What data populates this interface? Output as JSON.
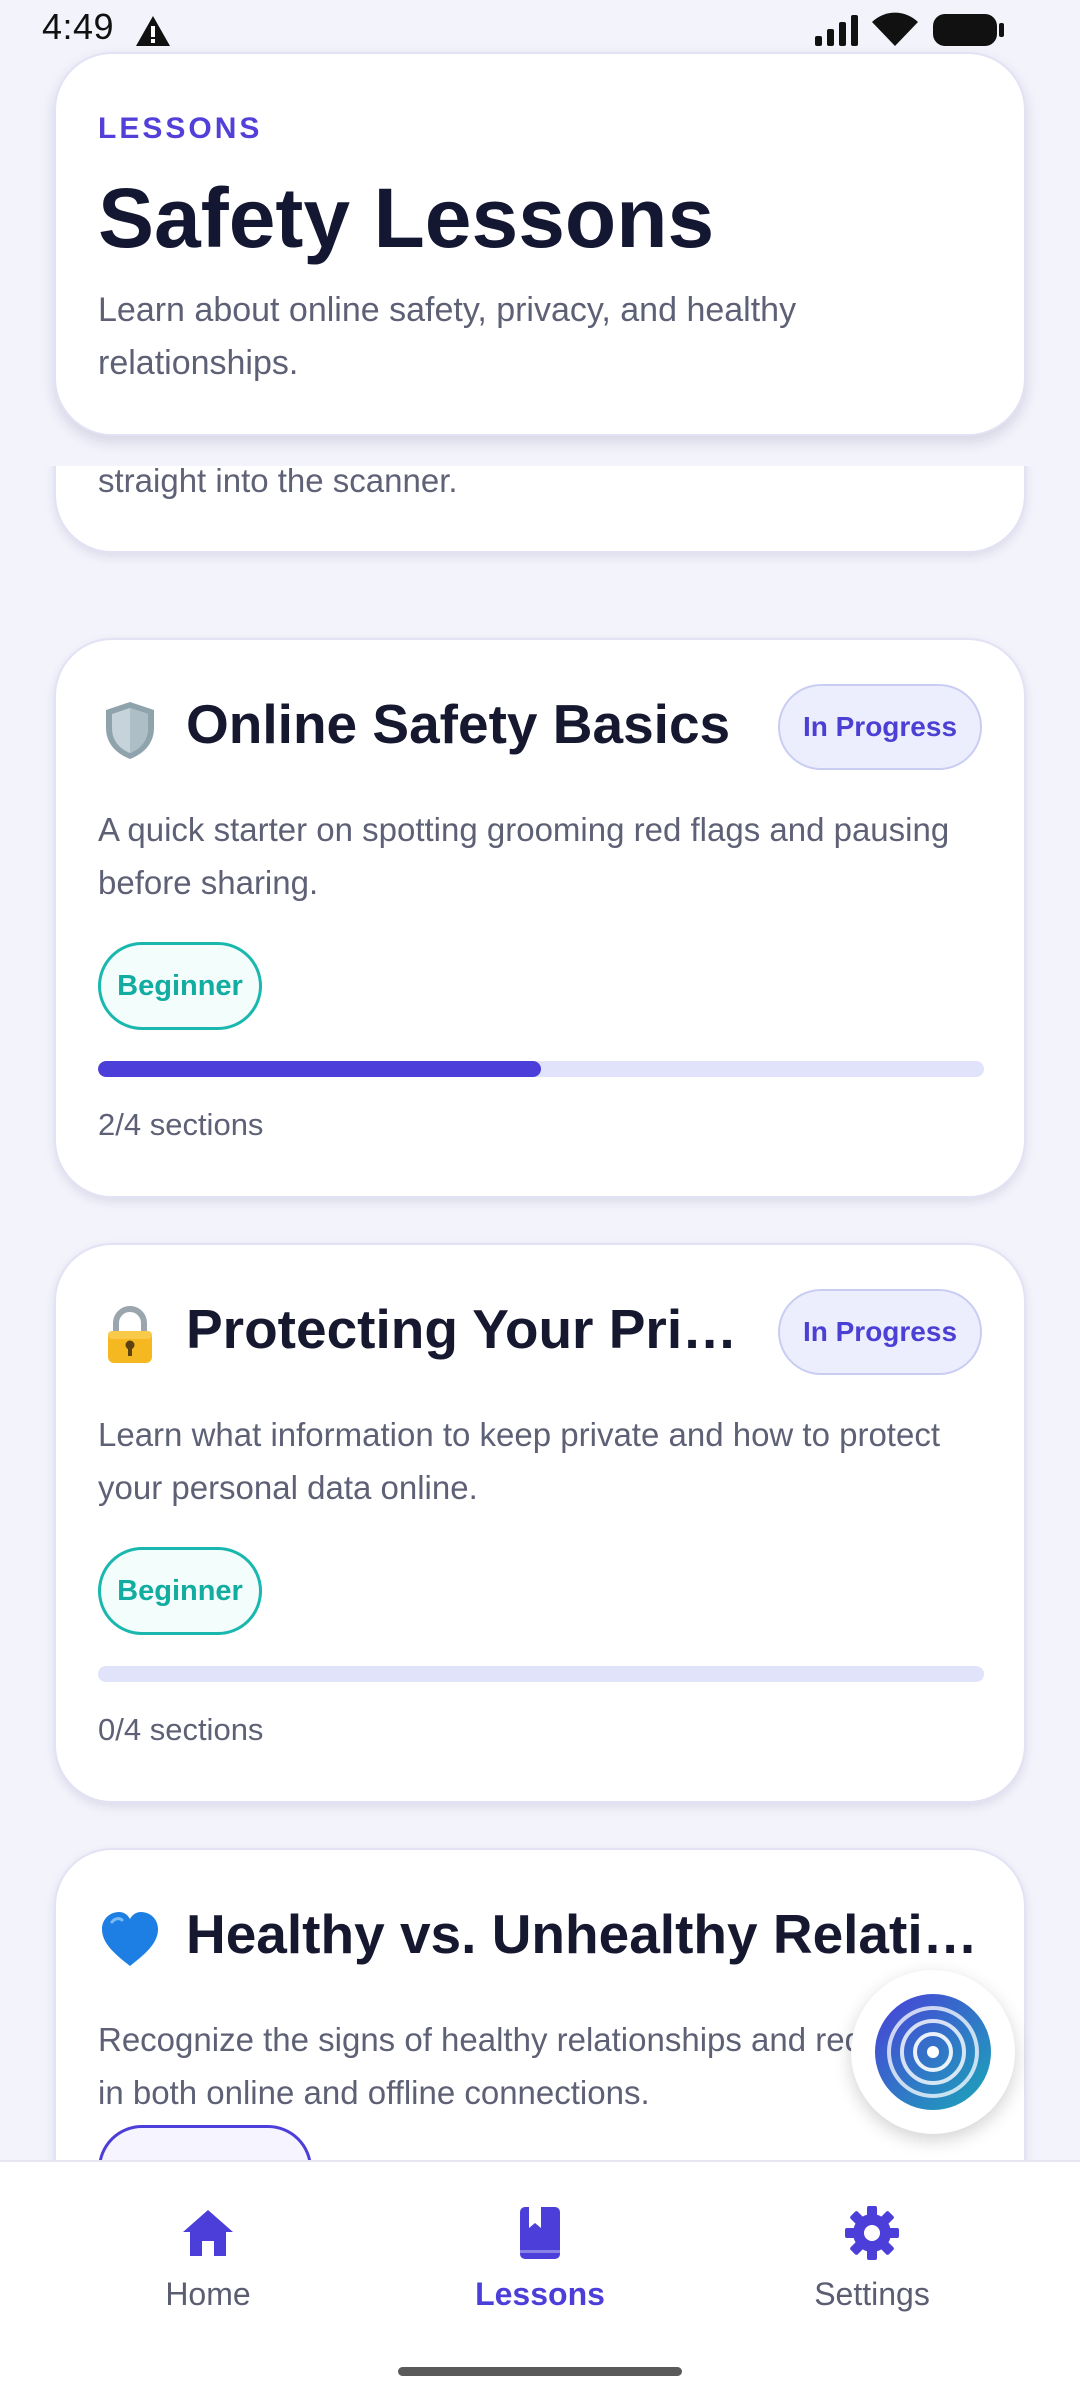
{
  "status_bar": {
    "time": "4:49"
  },
  "header": {
    "eyebrow": "LESSONS",
    "title": "Safety Lessons",
    "subtitle": "Learn about online safety, privacy, and healthy relationships."
  },
  "partial_card": {
    "text": "straight into the scanner."
  },
  "lessons": [
    {
      "icon": "shield-icon",
      "title": "Online Safety Basics",
      "status": "In Progress",
      "description": "A quick starter on spotting grooming red flags and pausing before sharing.",
      "level": "Beginner",
      "progress": 0.5,
      "progress_text": "2/4 sections"
    },
    {
      "icon": "lock-icon",
      "title": "Protecting Your Priv…",
      "status": "In Progress",
      "description": "Learn what information to keep private and how to protect your personal data online.",
      "level": "Beginner",
      "progress": 0,
      "progress_text": "0/4 sections"
    },
    {
      "icon": "blue-heart-icon",
      "title": "Healthy vs. Unhealthy Relatio…",
      "description": "Recognize the signs of healthy relationships and red flags in both online and offline connections."
    }
  ],
  "fab": {
    "icon": "scanner-rings-icon"
  },
  "bottom_nav": {
    "items": [
      {
        "label": "Home",
        "icon": "home-icon",
        "active": false
      },
      {
        "label": "Lessons",
        "icon": "book-icon",
        "active": true
      },
      {
        "label": "Settings",
        "icon": "gear-icon",
        "active": false
      }
    ]
  },
  "colors": {
    "accent": "#4c3ed9",
    "teal": "#13aca1",
    "background": "#f3f3fc"
  }
}
